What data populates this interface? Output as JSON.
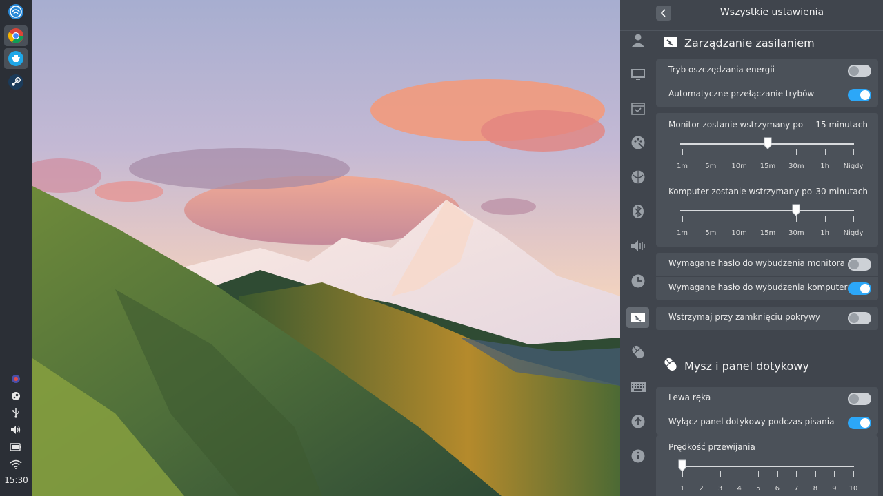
{
  "dock": {
    "apps": [
      {
        "name": "deepin-launcher-icon"
      },
      {
        "name": "chrome-icon"
      },
      {
        "name": "deepin-store-icon"
      },
      {
        "name": "steam-icon"
      }
    ],
    "tray": [
      "network-manager-icon",
      "steam-tray-icon",
      "usb-icon",
      "volume-icon",
      "battery-icon",
      "wifi-icon"
    ],
    "clock": "15:30"
  },
  "panel": {
    "title": "Wszystkie ustawienia",
    "nav": [
      "account-icon",
      "display-icon",
      "default-apps-icon",
      "personalization-icon",
      "network-icon",
      "bluetooth-icon",
      "sound-icon",
      "time-icon",
      "power-icon",
      "mouse-icon",
      "keyboard-icon",
      "update-icon",
      "info-icon"
    ],
    "power": {
      "title": "Zarządzanie zasilaniem",
      "power_saving": {
        "label": "Tryb oszczędzania energii",
        "on": false
      },
      "auto_switch": {
        "label": "Automatyczne przełączanie trybów",
        "on": true
      },
      "monitor_sleep": {
        "label": "Monitor zostanie wstrzymany po",
        "value": "15 minutach",
        "ticks": [
          "1m",
          "5m",
          "10m",
          "15m",
          "30m",
          "1h",
          "Nigdy"
        ],
        "selected_index": 3
      },
      "computer_sleep": {
        "label": "Komputer zostanie wstrzymany po",
        "value": "30 minutach",
        "ticks": [
          "1m",
          "5m",
          "10m",
          "15m",
          "30m",
          "1h",
          "Nigdy"
        ],
        "selected_index": 4
      },
      "monitor_password": {
        "label": "Wymagane hasło do wybudzenia monitora",
        "on": false
      },
      "computer_password": {
        "label": "Wymagane hasło do wybudzenia komputera",
        "on": true
      },
      "lid_suspend": {
        "label": "Wstrzymaj przy zamknięciu pokrywy",
        "on": false
      }
    },
    "mouse": {
      "title": "Mysz i panel dotykowy",
      "left_hand": {
        "label": "Lewa ręka",
        "on": false
      },
      "disable_touchpad": {
        "label": "Wyłącz panel dotykowy podczas pisania",
        "on": true
      },
      "scroll_speed": {
        "label": "Prędkość przewijania",
        "ticks": [
          "1",
          "2",
          "3",
          "4",
          "5",
          "6",
          "7",
          "8",
          "9",
          "10"
        ],
        "selected_index": 0
      }
    }
  },
  "colors": {
    "accent": "#2ca7f8",
    "panel_bg": "#40454d",
    "group_bg": "#4b5159",
    "dock_bg": "#2b2f36"
  }
}
